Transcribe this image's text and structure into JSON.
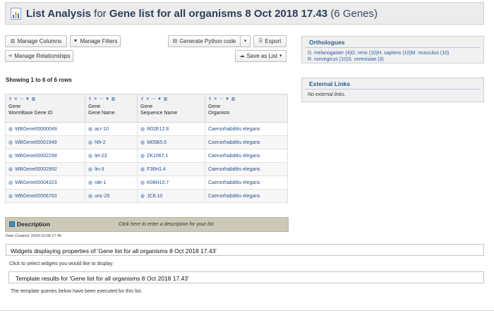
{
  "header": {
    "title_lead": "List Analysis",
    "title_for": " for ",
    "list_name": "Gene list for all organisms 8 Oct 2018 17.43",
    "gene_count": "(6 Genes)"
  },
  "toolbar": {
    "manage_columns": "Manage Columns",
    "manage_filters": "Manage Filters",
    "generate_python": "Generate Python code",
    "export": "Export",
    "manage_relationships": "Manage Relationships",
    "save_as_list": "Save as List"
  },
  "table": {
    "showing": "Showing 1 to 6 of 6 rows",
    "columns": [
      {
        "line1": "Gene",
        "line2": "WormBase Gene ID"
      },
      {
        "line1": "Gene",
        "line2": "Gene Name"
      },
      {
        "line1": "Gene",
        "line2": "Sequence Name"
      },
      {
        "line1": "Gene",
        "line2": "Organism"
      }
    ],
    "rows": [
      [
        "WBGene00000049",
        "acr-10",
        "R02E12.8",
        "Caenorhabditis elegans"
      ],
      [
        "WBGene00001949",
        "hlh-2",
        "M05B5.5",
        "Caenorhabditis elegans"
      ],
      [
        "WBGene00002299",
        "let-23",
        "ZK1067.1",
        "Caenorhabditis elegans"
      ],
      [
        "WBGene00002992",
        "lin-3",
        "F36H1.4",
        "Caenorhabditis elegans"
      ],
      [
        "WBGene00004323",
        "rde-1",
        "K08H10.7",
        "Caenorhabditis elegans"
      ],
      [
        "WBGene00006763",
        "unc-26",
        "JC8.10",
        "Caenorhabditis elegans"
      ]
    ]
  },
  "orthologues": {
    "title": "Orthologues",
    "line1": "D. melanogaster (4)D. rerio (10)H. sapiens (10)M. musculus (10)",
    "line2": "R. norvegicus (10)S. cerevisiae (3)"
  },
  "external_links": {
    "title": "External Links",
    "body": "No external links."
  },
  "description": {
    "label": "Description",
    "click_text": "Click here to enter a description for your list",
    "date_created": "Date Created:  2018-10-08 17:45"
  },
  "widgets": {
    "title": "Widgets displaying properties of 'Gene list for all organisms 8 Oct 2018 17.43'",
    "click_text": "Click to select widgets you would like to display:"
  },
  "templates": {
    "title": "Template results for 'Gene list for all organisms 8 Oct 2018 17.43'",
    "note": "The template queries below have been executed for this list."
  },
  "colors": {
    "accent": "#2c3e5a",
    "link": "#2a4f8c",
    "description_bar": "#cdc9b8"
  }
}
